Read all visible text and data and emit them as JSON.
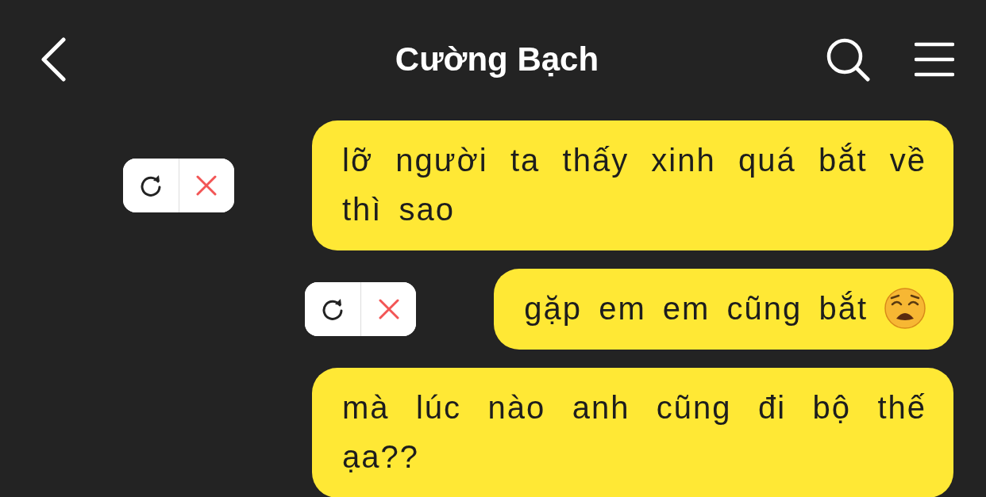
{
  "header": {
    "title": "Cường Bạch"
  },
  "messages": [
    {
      "text": "lỡ người ta thấy xinh quá bắt về thì sao",
      "failed": true,
      "emoji": false
    },
    {
      "text": "gặp em em cũng bắt",
      "failed": true,
      "emoji": true
    },
    {
      "text": "mà lúc nào anh cũng đi bộ thế ạa??",
      "failed": false,
      "emoji": false
    }
  ]
}
